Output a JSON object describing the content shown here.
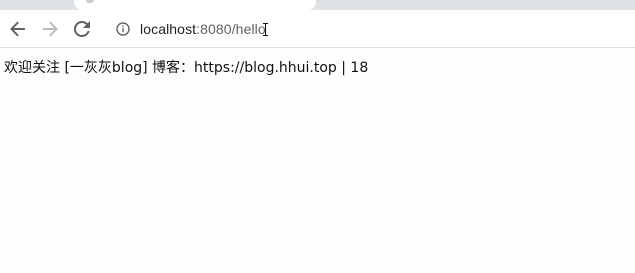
{
  "browser": {
    "address_bar": {
      "host": "localhost",
      "path": ":8080/hello"
    },
    "icons": {
      "back": "arrow-left-icon",
      "forward": "arrow-right-icon",
      "reload": "reload-icon",
      "site_info": "info-icon"
    },
    "colors": {
      "tab_strip": "#dee1e6",
      "toolbar": "#ffffff",
      "icon_active": "#5f6368",
      "icon_disabled": "#b9bcc0"
    }
  },
  "page": {
    "content": "欢迎关注 [一灰灰blog] 博客：https://blog.hhui.top | 18"
  }
}
